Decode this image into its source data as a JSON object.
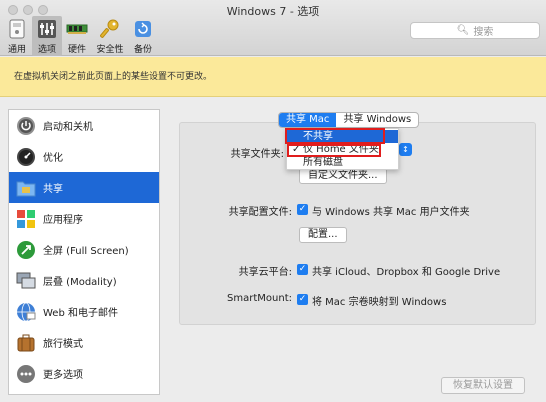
{
  "window": {
    "title": "Windows 7 - 选项"
  },
  "search": {
    "placeholder": "搜索",
    "icon": "search-icon"
  },
  "toolbar": [
    {
      "label": "通用",
      "icon": "general-icon"
    },
    {
      "label": "选项",
      "icon": "options-icon",
      "selected": true
    },
    {
      "label": "硬件",
      "icon": "hardware-icon"
    },
    {
      "label": "安全性",
      "icon": "key-icon"
    },
    {
      "label": "备份",
      "icon": "backup-icon"
    }
  ],
  "banner": {
    "text": "在虚拟机关闭之前此页面上的某些设置不可更改。"
  },
  "sidebar": {
    "items": [
      {
        "label": "启动和关机",
        "icon": "power-icon"
      },
      {
        "label": "优化",
        "icon": "speedometer-icon"
      },
      {
        "label": "共享",
        "icon": "folder-icon",
        "selected": true
      },
      {
        "label": "应用程序",
        "icon": "windows-apps-icon"
      },
      {
        "label": "全屏 (Full Screen)",
        "icon": "fullscreen-icon"
      },
      {
        "label": "层叠 (Modality)",
        "icon": "modality-icon"
      },
      {
        "label": "Web 和电子邮件",
        "icon": "globe-icon"
      },
      {
        "label": "旅行模式",
        "icon": "suitcase-icon"
      },
      {
        "label": "更多选项",
        "icon": "more-icon"
      }
    ]
  },
  "segment": {
    "left": "共享 Mac",
    "right": "共享 Windows",
    "selected": "共享 Mac"
  },
  "share_folders": {
    "label": "共享文件夹:",
    "menu_options": [
      "不共享",
      "仅 Home 文件夹",
      "所有磁盘"
    ],
    "highlighted": "不共享",
    "checked": "仅 Home 文件夹",
    "custom_button": "自定义文件夹..."
  },
  "profile": {
    "label": "共享配置文件:",
    "text": "与 Windows 共享 Mac 用户文件夹",
    "checked": true,
    "config_button": "配置..."
  },
  "cloud": {
    "label": "共享云平台:",
    "text": "共享 iCloud、Dropbox 和 Google Drive",
    "checked": true
  },
  "smartmount": {
    "label": "SmartMount:",
    "text": "将 Mac 宗卷映射到 Windows",
    "checked": true
  },
  "restore_button": "恢复默认设置",
  "colors": {
    "accent": "#1e7df0",
    "selection": "#1e68d6",
    "banner": "#fbe99a",
    "annotation": "#e01d1d"
  }
}
